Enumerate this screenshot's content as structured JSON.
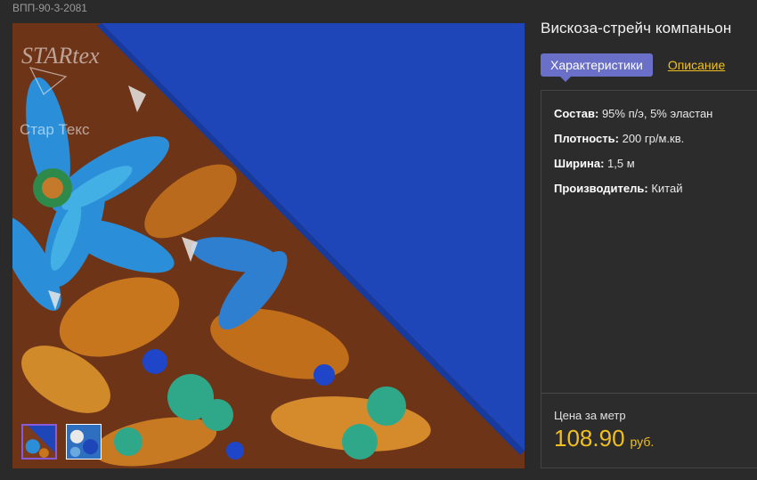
{
  "sku": "ВПП-90-3-2081",
  "product": {
    "title": "Вискоза-стрейч компаньон"
  },
  "tabs": {
    "characteristics": "Характеристики",
    "description": "Описание"
  },
  "specs": [
    {
      "key": "Состав:",
      "value": "95% п/э, 5% эластан"
    },
    {
      "key": "Плотность:",
      "value": "200 гр/м.кв."
    },
    {
      "key": "Ширина:",
      "value": "1,5 м"
    },
    {
      "key": "Производитель:",
      "value": "Китай"
    }
  ],
  "price": {
    "label": "Цена за метр",
    "value": "108.90",
    "currency": "руб."
  },
  "watermark": {
    "brand": "STARtex",
    "caption": "Стар Текс"
  },
  "colors": {
    "accent_tab": "#6a70c8",
    "price": "#f0c020",
    "fabric_blue": "#1f46b8"
  }
}
